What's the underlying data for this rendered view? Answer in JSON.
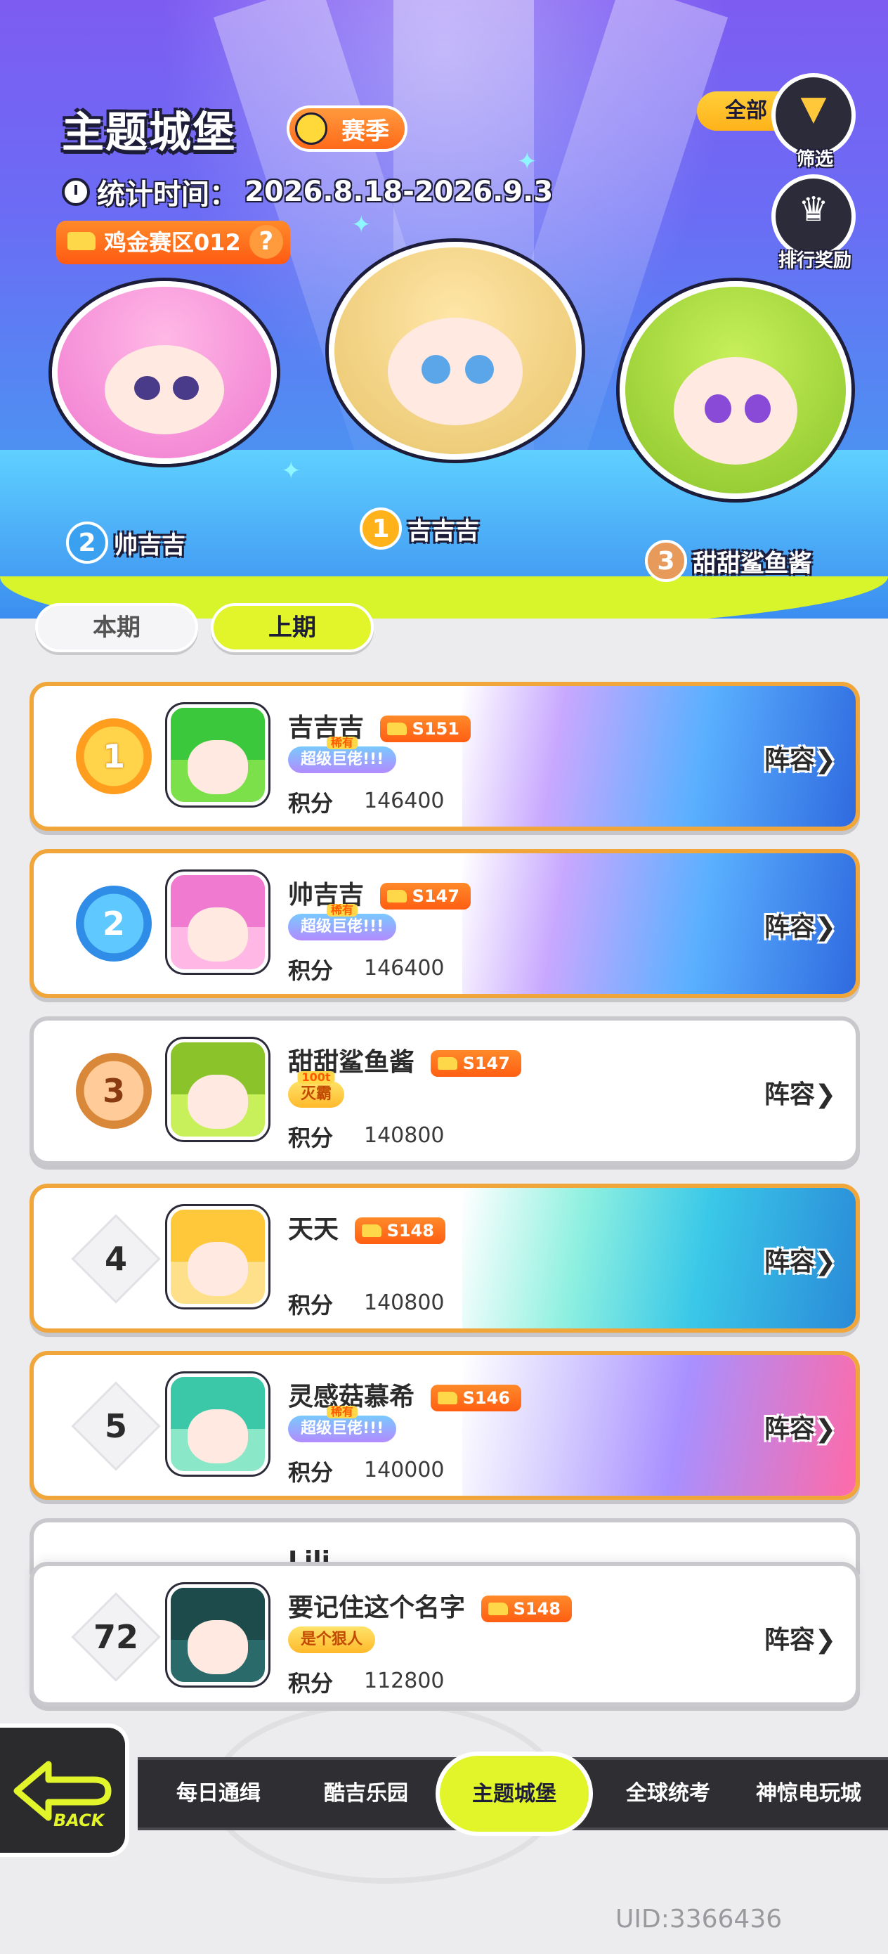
{
  "header": {
    "title": "主题城堡",
    "season_badge": "赛季",
    "stat_label": "统计时间：",
    "stat_range": "2026.8.18-2026.9.3",
    "region_tag": "鸡金赛区012",
    "region_help": "?",
    "filter_label": "全部",
    "filter_caption": "筛选",
    "reward_caption": "排行奖励"
  },
  "podium": [
    {
      "rank": "2",
      "name": "帅吉吉"
    },
    {
      "rank": "1",
      "name": "吉吉吉"
    },
    {
      "rank": "3",
      "name": "甜甜鲨鱼酱"
    }
  ],
  "tabs": {
    "current": "本期",
    "previous": "上期",
    "active": "previous"
  },
  "rankings": [
    {
      "rank": "1",
      "name": "吉吉吉",
      "season": "S151",
      "title_top": "稀有",
      "title": "超级巨佬!!!",
      "score_label": "积分",
      "score": "146400",
      "lineup": "阵容"
    },
    {
      "rank": "2",
      "name": "帅吉吉",
      "season": "S147",
      "title_top": "稀有",
      "title": "超级巨佬!!!",
      "score_label": "积分",
      "score": "146400",
      "lineup": "阵容"
    },
    {
      "rank": "3",
      "name": "甜甜鲨鱼酱",
      "season": "S147",
      "title_top": "100t",
      "title": "灭霸",
      "score_label": "积分",
      "score": "140800",
      "lineup": "阵容"
    },
    {
      "rank": "4",
      "name": "天天",
      "season": "S148",
      "score_label": "积分",
      "score": "140800",
      "lineup": "阵容"
    },
    {
      "rank": "5",
      "name": "灵感菇慕希",
      "season": "S146",
      "title_top": "稀有",
      "title": "超级巨佬!!!",
      "score_label": "积分",
      "score": "140000",
      "lineup": "阵容"
    }
  ],
  "partial_row": {
    "name": "Lili"
  },
  "my_rank": {
    "rank": "72",
    "name": "要记住这个名字",
    "season": "S148",
    "title": "是个狠人",
    "score_label": "积分",
    "score": "112800",
    "lineup": "阵容"
  },
  "back": {
    "label": "BACK"
  },
  "nav": [
    "每日通缉",
    "酷吉乐园",
    "主题城堡",
    "全球统考",
    "神惊电玩城"
  ],
  "nav_active": "主题城堡",
  "uid": "UID:3366436",
  "colors": {
    "accent_lime": "#e2f52b",
    "card_gold_border": "#f0a63a",
    "card_grey_border": "#c9c9cd",
    "season_orange": "#ff6a1a"
  },
  "icons": [
    "clock-icon",
    "filter-icon",
    "reward-icon",
    "gun-icon",
    "question-icon",
    "chevron-right-icon",
    "back-arrow-icon"
  ]
}
